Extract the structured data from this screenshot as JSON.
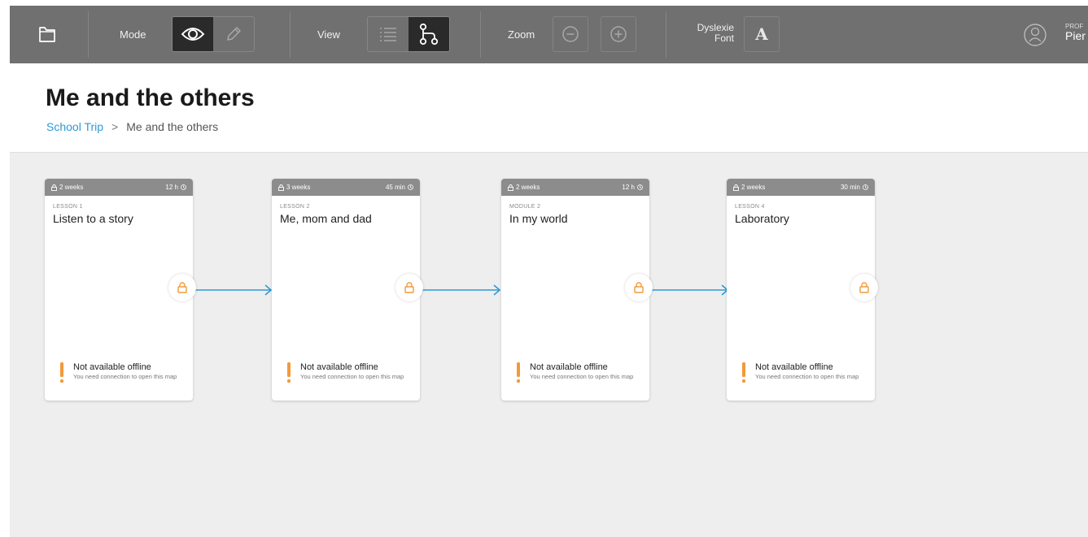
{
  "toolbar": {
    "mode_label": "Mode",
    "view_label": "View",
    "zoom_label": "Zoom",
    "dyslexie_label_line1": "Dyslexie",
    "dyslexie_label_line2": "Font",
    "dyslexie_glyph": "A",
    "profile_label": "PROF",
    "profile_name": "Pier"
  },
  "header": {
    "title": "Me and the others",
    "breadcrumb_root": "School Trip",
    "breadcrumb_sep": ">",
    "breadcrumb_current": "Me and the others"
  },
  "colors": {
    "toolbar_bg": "#707070",
    "active_toggle": "#2a2a2a",
    "accent_blue": "#2d9ad6",
    "warning_orange": "#f29a3a",
    "card_bar": "#8c8c8c"
  },
  "cards": [
    {
      "duration": "2 weeks",
      "time": "12 h",
      "kicker": "LESSON 1",
      "title": "Listen to a story",
      "warn_title": "Not available offline",
      "warn_sub": "You need connection to open this map"
    },
    {
      "duration": "3 weeks",
      "time": "45 min",
      "kicker": "LESSON 2",
      "title": "Me, mom and dad",
      "warn_title": "Not available offline",
      "warn_sub": "You need connection to open this map"
    },
    {
      "duration": "2 weeks",
      "time": "12 h",
      "kicker": "MODULE 2",
      "title": "In my world",
      "warn_title": "Not available offline",
      "warn_sub": "You need connection to open this map"
    },
    {
      "duration": "2 weeks",
      "time": "30 min",
      "kicker": "LESSON 4",
      "title": "Laboratory",
      "warn_title": "Not available offline",
      "warn_sub": "You need connection to open this map"
    }
  ]
}
